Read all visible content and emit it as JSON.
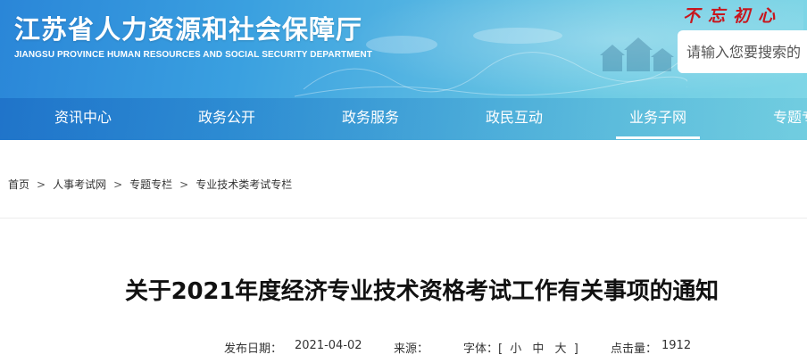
{
  "header": {
    "site_title": "江苏省人力资源和社会保障厅",
    "site_subtitle": "JIANGSU PROVINCE HUMAN RESOURCES AND SOCIAL SECURITY DEPARTMENT",
    "slogan": "不忘初心",
    "search_placeholder": "请输入您要搜索的"
  },
  "nav": {
    "items": [
      {
        "label": "资讯中心"
      },
      {
        "label": "政务公开"
      },
      {
        "label": "政务服务"
      },
      {
        "label": "政民互动"
      },
      {
        "label": "业务子网"
      },
      {
        "label": "专题专栏"
      }
    ],
    "active": "业务子网"
  },
  "breadcrumb": {
    "items": [
      "首页",
      "人事考试网",
      "专题专栏",
      "专业技术类考试专栏"
    ],
    "separator": ">"
  },
  "article": {
    "title": "关于2021年度经济专业技术资格考试工作有关事项的通知",
    "publish_label": "发布日期：",
    "publish_date": "2021-04-02",
    "source_label": "来源：",
    "source_value": "",
    "font_label": "字体：[",
    "font_small": "小",
    "font_medium": "中",
    "font_large": "大",
    "font_close": "]",
    "hits_label": "点击量：",
    "hits_value": "1912"
  },
  "colors": {
    "header_blue": "#2a86d8",
    "header_teal": "#7fd6e6",
    "slogan_red": "#c8161d"
  }
}
